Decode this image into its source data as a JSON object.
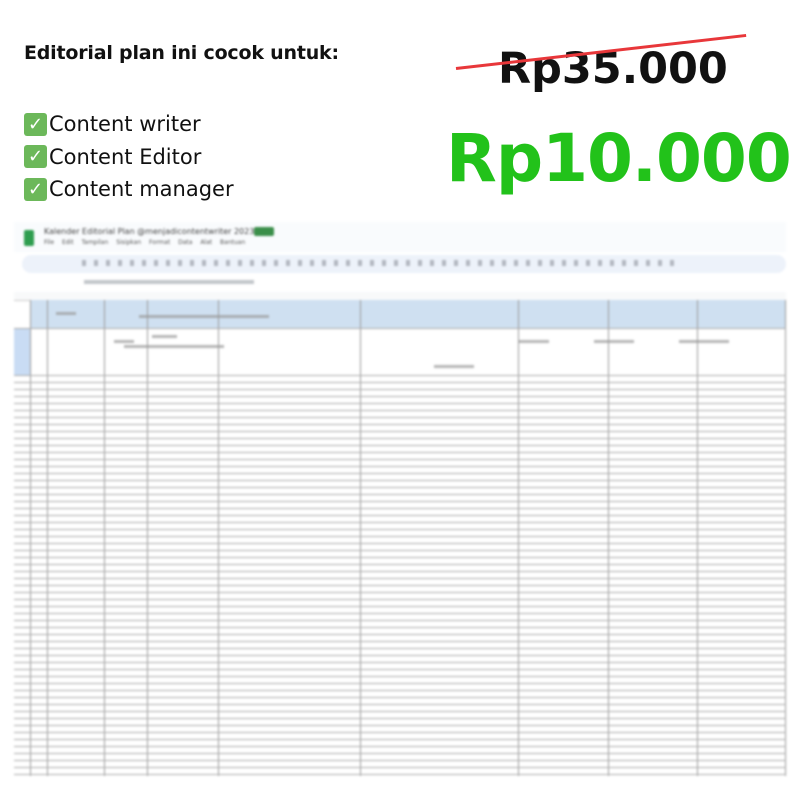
{
  "promo": {
    "heading": "Editorial plan ini cocok untuk:",
    "audience": [
      "Content writer",
      "Content Editor",
      "Content manager"
    ],
    "check_icon": "white-check-mark-green-box",
    "old_price": "Rp35.000",
    "new_price": "Rp10.000",
    "colors": {
      "new_price": "#22c21a",
      "strike": "#e8373a",
      "check": "#6cb85a"
    }
  },
  "spreadsheet": {
    "title": "Kalender Editorial Plan @menjadicontentwriter 2023",
    "menu": "File Edit Tampilan Sisipkan Format Data Alat Bantuan",
    "blurred": true
  }
}
